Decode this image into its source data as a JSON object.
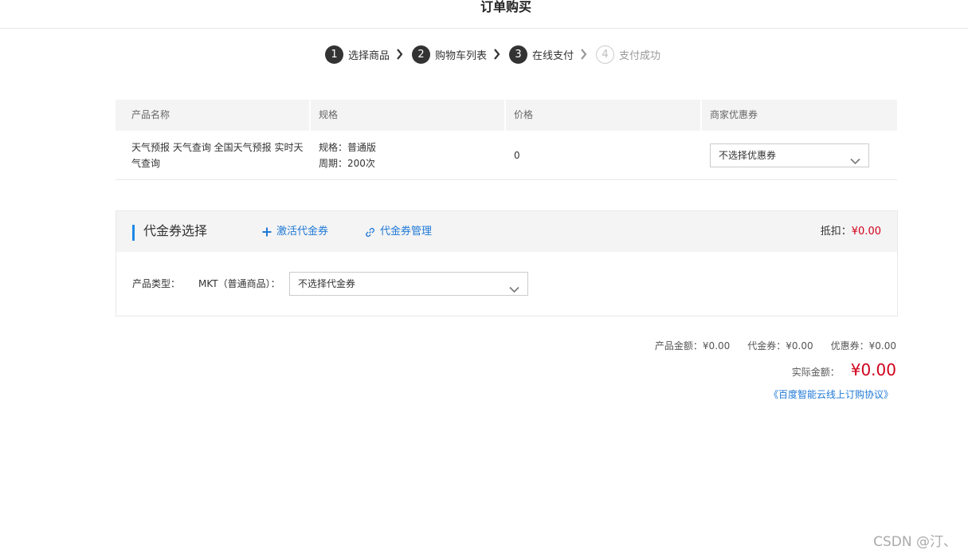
{
  "header": {
    "title": "订单购买"
  },
  "steps": [
    {
      "num": "1",
      "label": "选择商品",
      "state": "done"
    },
    {
      "num": "2",
      "label": "购物车列表",
      "state": "done"
    },
    {
      "num": "3",
      "label": "在线支付",
      "state": "current"
    },
    {
      "num": "4",
      "label": "支付成功",
      "state": "pending"
    }
  ],
  "product_table": {
    "columns": [
      "产品名称",
      "规格",
      "价格",
      "商家优惠券"
    ],
    "rows": [
      {
        "name": "天气预报 天气查询 全国天气预报 实时天气查询",
        "spec_line1": "规格：普通版",
        "spec_line2": "周期：200次",
        "price": "0",
        "coupon_selected": "不选择优惠券"
      }
    ]
  },
  "voucher": {
    "title": "代金券选择",
    "activate_label": "激活代金券",
    "manage_label": "代金券管理",
    "deduct_label": "抵扣：",
    "deduct_value": "¥0.00",
    "type_label": "产品类型：",
    "type_value": "MKT（普通商品）：",
    "voucher_selected": "不选择代金券"
  },
  "summary": {
    "product_amount": "产品金额：¥0.00",
    "voucher_amount": "代金券：¥0.00",
    "coupon_amount": "优惠券：¥0.00",
    "actual_label": "实际金额：",
    "actual_value": "¥0.00",
    "agreement": "《百度智能云线上订购协议》"
  },
  "watermark": "CSDN @汀、",
  "colors": {
    "accent": "#1e88e5",
    "link": "#1e78d6",
    "price_red": "#d0021b",
    "step_dark": "#333333"
  },
  "icons": [
    "chevron-right-icon",
    "chevron-down-icon",
    "plus-icon",
    "link-icon"
  ]
}
